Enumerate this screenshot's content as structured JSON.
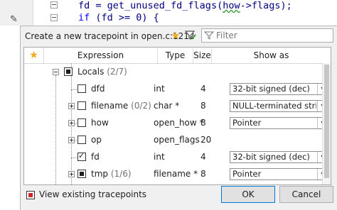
{
  "editor": {
    "line1": [
      "fd = ",
      "get_unused_fd_flags",
      "(",
      "how",
      "->flags);"
    ],
    "line2": [
      "if",
      " (fd >= 0) {"
    ]
  },
  "dialog": {
    "title": "Create a new tracepoint in open.c:1212",
    "filter_placeholder": "Filter"
  },
  "table": {
    "columns": [
      "Expression",
      "Type",
      "Size",
      "Show as"
    ],
    "rows": [
      {
        "name": "Locals",
        "count": "(2/7)",
        "type": "",
        "size": "",
        "show": ""
      },
      {
        "name": "dfd",
        "count": "",
        "type": "int",
        "size": "4",
        "show": "32-bit signed (dec)"
      },
      {
        "name": "filename",
        "count": "(0/2)",
        "type": "char *",
        "size": "8",
        "show": "NULL-terminated string"
      },
      {
        "name": "how",
        "count": "",
        "type": "open_how *",
        "size": "8",
        "show": "Pointer"
      },
      {
        "name": "op",
        "count": "",
        "type": "open_flags",
        "size": "20",
        "show": ""
      },
      {
        "name": "fd",
        "count": "",
        "type": "int",
        "size": "4",
        "show": "32-bit signed (dec)"
      },
      {
        "name": "tmp",
        "count": "(1/6)",
        "type": "filename *",
        "size": "8",
        "show": "Pointer"
      }
    ]
  },
  "footer": {
    "view_existing_label": "View existing tracepoints",
    "ok_label": "OK",
    "cancel_label": "Cancel"
  },
  "colors": {
    "star": "#f2a81d",
    "accent": "#0078d7",
    "tracepoint_marker": "#c8282b"
  },
  "icons": [
    "pencil-icon",
    "star-icon",
    "filter-icon",
    "search-filter-icon",
    "dropdown-arrow-icon"
  ]
}
